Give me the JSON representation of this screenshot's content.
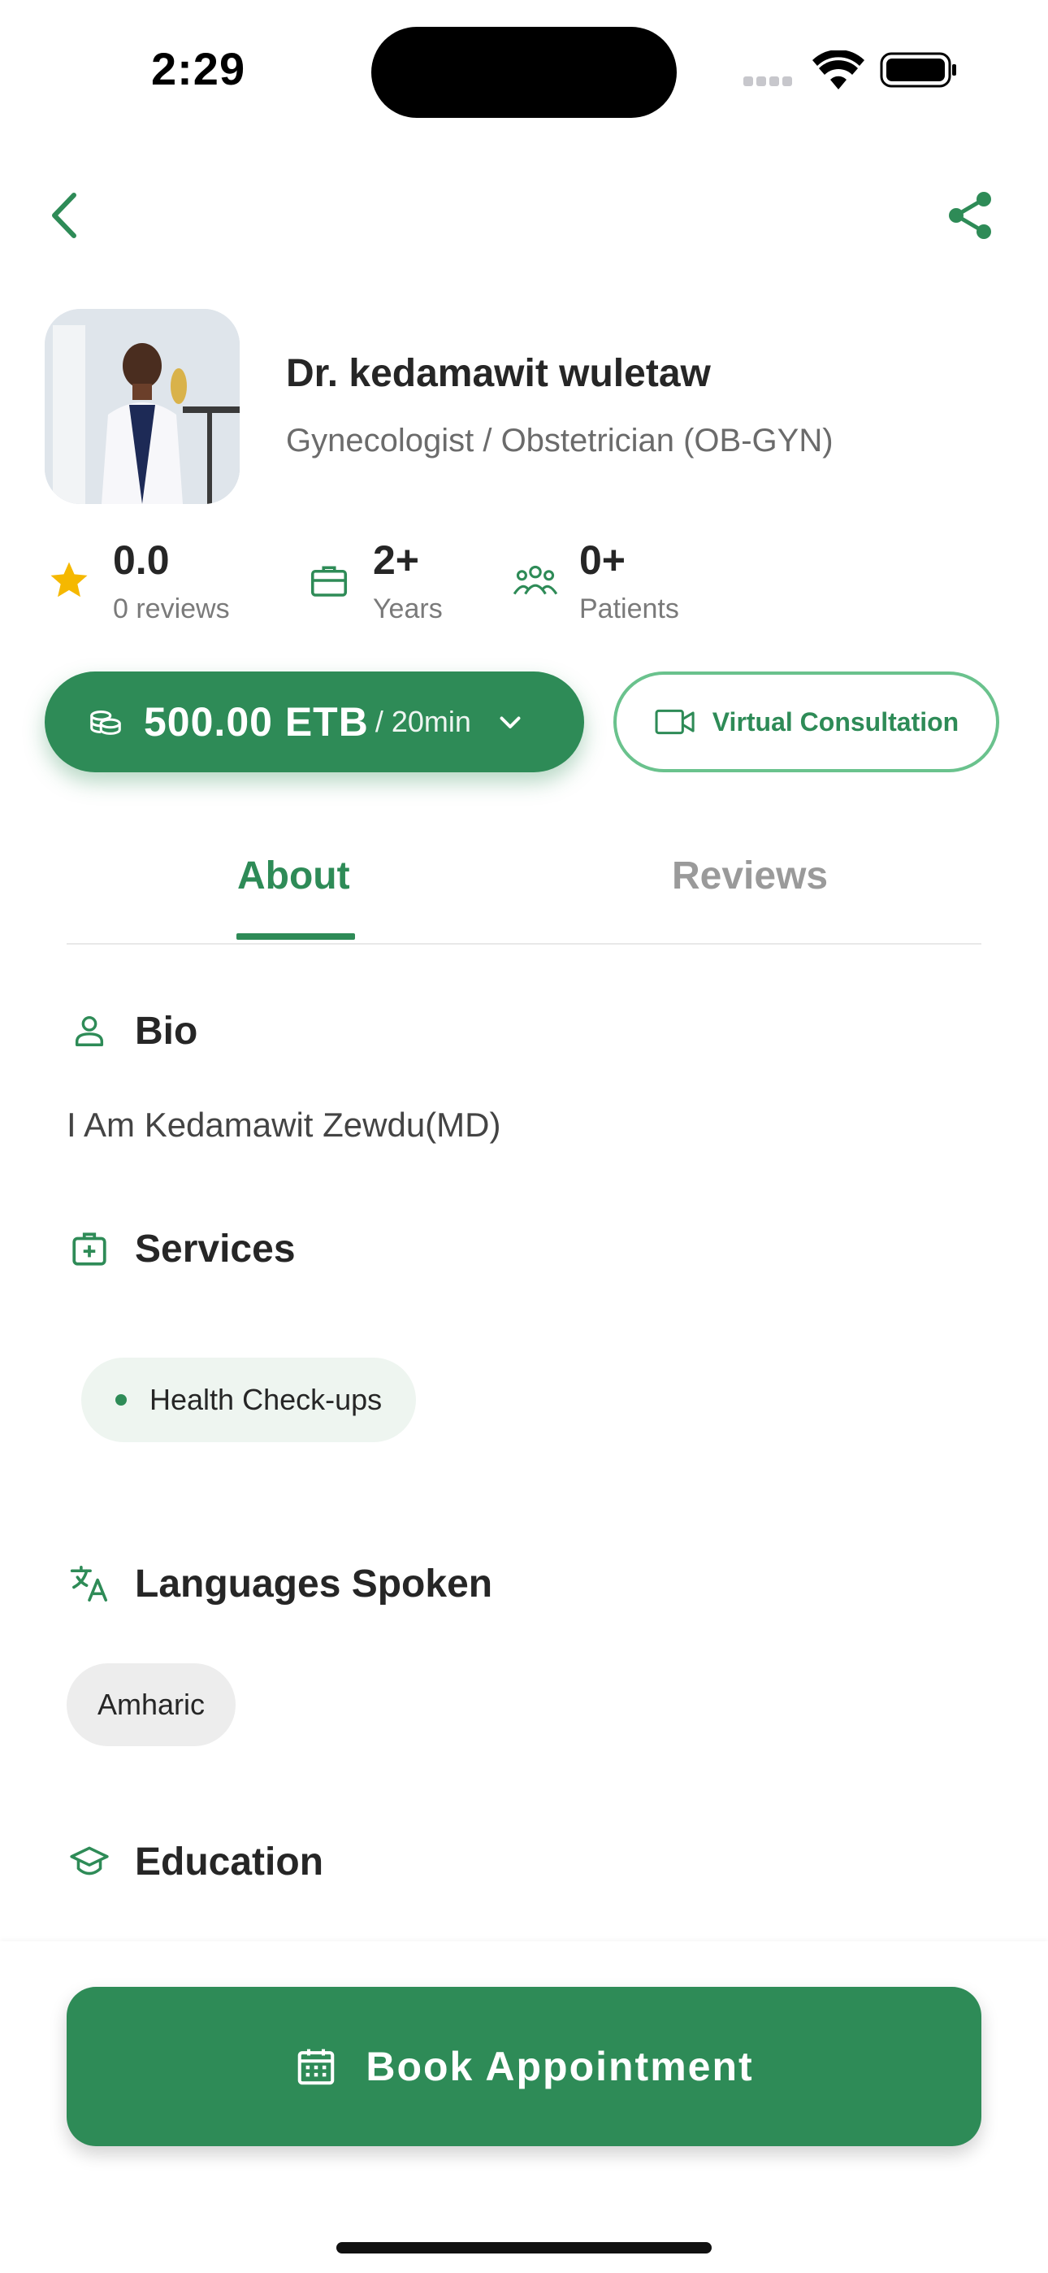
{
  "status_bar": {
    "time": "2:29"
  },
  "header": {
    "back_icon": "chevron-left-icon",
    "share_icon": "share-icon"
  },
  "doctor": {
    "name": "Dr. kedamawit wuletaw",
    "specialty": "Gynecologist / Obstetrician (OB-GYN)"
  },
  "stats": [
    {
      "icon": "star-icon",
      "value": "0.0",
      "label": "0 reviews"
    },
    {
      "icon": "briefcase-icon",
      "value": "2+",
      "label": "Years"
    },
    {
      "icon": "patients-icon",
      "value": "0+",
      "label": "Patients"
    }
  ],
  "pricing": {
    "amount": "500.00 ETB",
    "duration": "/ 20min"
  },
  "consultation": {
    "label": "Virtual Consultation"
  },
  "tabs": [
    {
      "label": "About",
      "active": true
    },
    {
      "label": "Reviews",
      "active": false
    }
  ],
  "sections": {
    "bio": {
      "title": "Bio",
      "text": "I Am Kedamawit Zewdu(MD)"
    },
    "services": {
      "title": "Services",
      "items": [
        "Health Check-ups"
      ]
    },
    "languages": {
      "title": "Languages Spoken",
      "items": [
        "Amharic"
      ]
    },
    "education": {
      "title": "Education"
    }
  },
  "cta": {
    "label": "Book Appointment"
  },
  "colors": {
    "accent": "#2e8b57",
    "accent_light": "#6ac28d",
    "star": "#f5b800",
    "muted": "#7a7a7a"
  }
}
